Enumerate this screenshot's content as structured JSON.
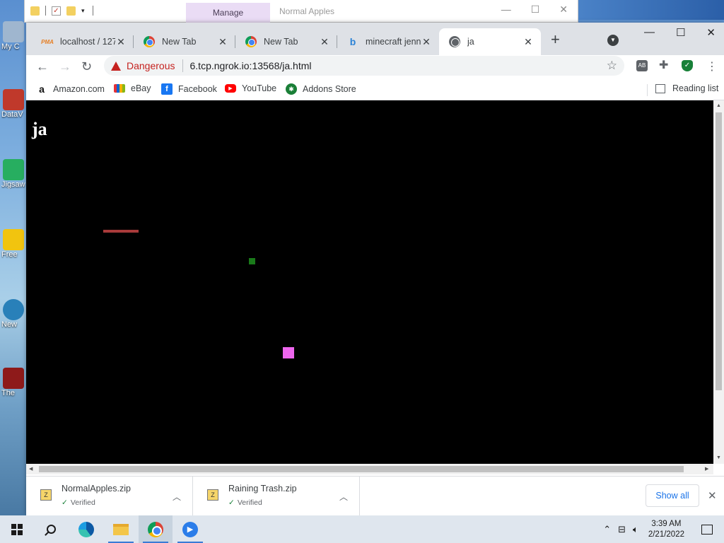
{
  "desktop": {
    "icons": [
      {
        "label": "My C",
        "color": "#9fb6cf"
      },
      {
        "label": "DataV",
        "color": "#c0392b"
      },
      {
        "label": "Jigsaw",
        "color": "#27ae60"
      },
      {
        "label": "Free",
        "color": "#f1c40f"
      },
      {
        "label": "New",
        "color": "#2980b9"
      },
      {
        "label": "The",
        "color": "#8e1a1a"
      }
    ]
  },
  "explorer": {
    "manage_label": "Manage",
    "title": "Normal Apples",
    "minimize": "—",
    "maximize": "☐",
    "close": "✕"
  },
  "browser": {
    "tabs": [
      {
        "title": "localhost / 127",
        "icon": "phpmyadmin-icon",
        "icon_text": "PMA"
      },
      {
        "title": "New Tab",
        "icon": "chrome-icon"
      },
      {
        "title": "New Tab",
        "icon": "chrome-icon"
      },
      {
        "title": "minecraft jenn",
        "icon": "bing-icon",
        "icon_text": "b"
      },
      {
        "title": "ja",
        "icon": "globe-icon",
        "active": true
      }
    ],
    "new_tab": "+",
    "window_controls": {
      "minimize": "—",
      "maximize": "☐",
      "close": "✕"
    },
    "nav": {
      "back": "←",
      "forward": "→",
      "reload": "↻"
    },
    "security_label": "Dangerous",
    "url": "6.tcp.ngrok.io:13568/ja.html",
    "star": "☆",
    "menu": "⋮",
    "bookmarks": [
      {
        "label": "Amazon.com",
        "icon": "amazon-icon",
        "icon_text": "a"
      },
      {
        "label": "eBay",
        "icon": "ebay-icon"
      },
      {
        "label": "Facebook",
        "icon": "facebook-icon",
        "icon_text": "f"
      },
      {
        "label": "YouTube",
        "icon": "youtube-icon",
        "icon_text": "▶"
      },
      {
        "label": "Addons Store",
        "icon": "addons-icon",
        "icon_text": "✱"
      }
    ],
    "reading_list": "Reading list"
  },
  "page": {
    "heading": "ja",
    "background": "#000000",
    "objects": [
      {
        "name": "paddle",
        "color": "#a83a3a"
      },
      {
        "name": "green-square",
        "color": "#1a7a1a"
      },
      {
        "name": "pink-square",
        "color": "#ee66ee"
      }
    ]
  },
  "downloads": {
    "items": [
      {
        "filename": "NormalApples.zip",
        "status": "Verified"
      },
      {
        "filename": "Raining Trash.zip",
        "status": "Verified"
      }
    ],
    "show_all": "Show all",
    "close": "✕"
  },
  "taskbar": {
    "time": "3:39 AM",
    "date": "2/21/2022"
  }
}
